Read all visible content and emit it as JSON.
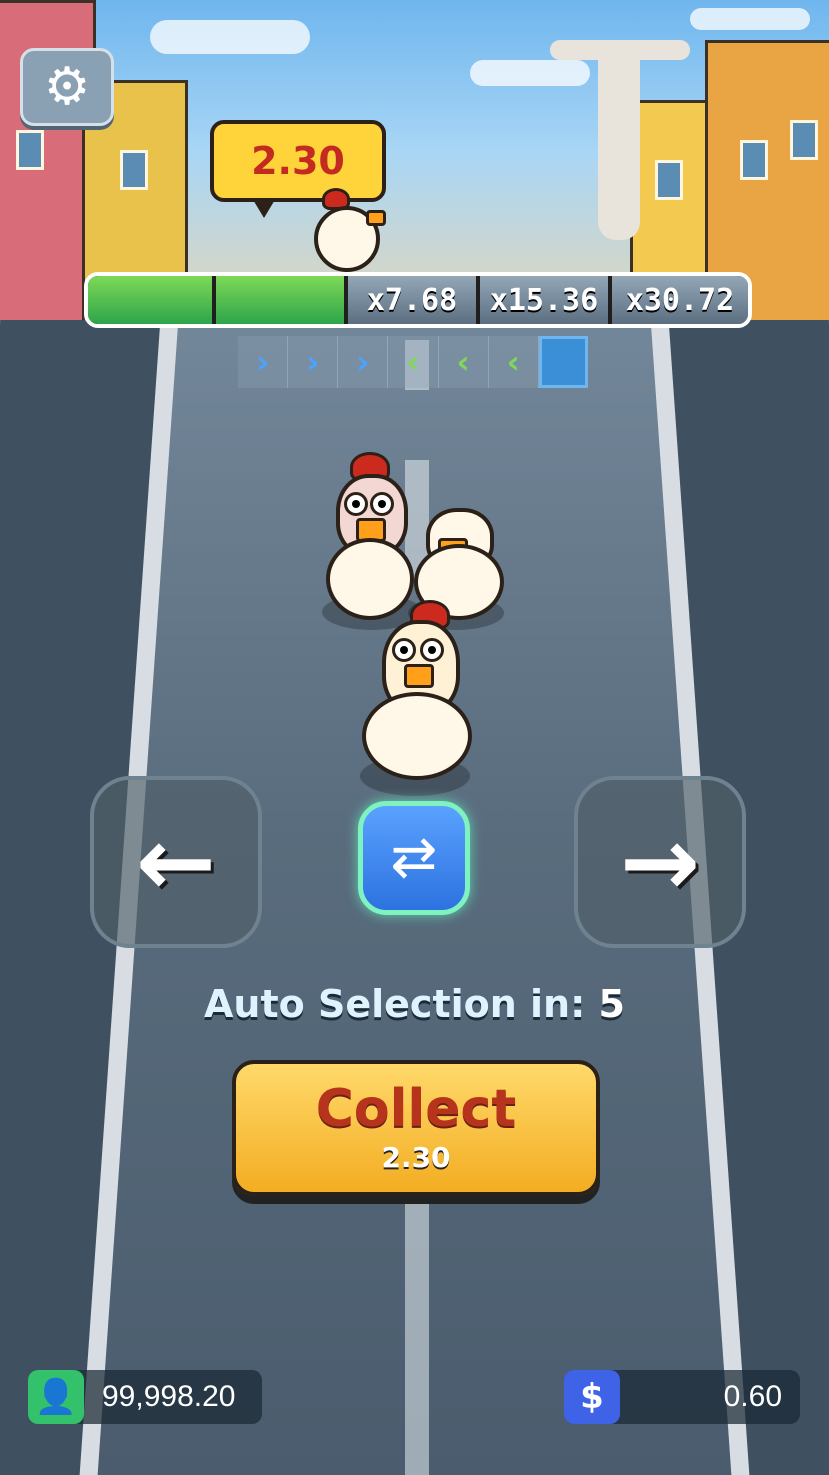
{
  "game": {
    "current_multiplier_bubble": "2.30",
    "progress": {
      "completed_segments": 2,
      "total_segments": 5,
      "next_multipliers": [
        "x7.68",
        "x15.36",
        "x30.72"
      ]
    },
    "auto_selection": {
      "label": "Auto Selection in:",
      "countdown": "5"
    },
    "collect_button": {
      "label": "Collect",
      "amount": "2.30"
    },
    "balance": {
      "value": "99,998.20",
      "icon": "user-icon",
      "icon_color": "#33c26b"
    },
    "bet": {
      "value": "0.60",
      "icon": "dollar-icon",
      "icon_color": "#3f63e6"
    },
    "hints": [
      {
        "direction": "right",
        "icon": "chevron-right-icon"
      },
      {
        "direction": "right",
        "icon": "chevron-right-icon"
      },
      {
        "direction": "right",
        "icon": "chevron-right-icon"
      },
      {
        "direction": "left",
        "icon": "chevron-left-icon"
      },
      {
        "direction": "left",
        "icon": "chevron-left-icon"
      },
      {
        "direction": "left",
        "icon": "chevron-left-icon"
      },
      {
        "direction": "current",
        "icon": ""
      }
    ],
    "controls": {
      "left_icon": "arrow-left-icon",
      "right_icon": "arrow-right-icon",
      "random_icon": "shuffle-icon",
      "settings_icon": "gear-icon"
    },
    "colors": {
      "progress_done": "#44b84f",
      "collect_bg": "#ffd04a",
      "collect_text": "#b5341b",
      "bubble_bg": "#ffd43b",
      "bubble_text": "#c42b20"
    }
  }
}
